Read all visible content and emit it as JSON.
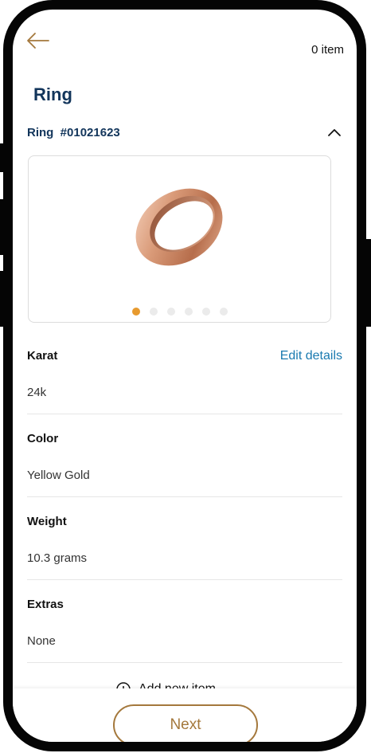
{
  "header": {
    "back_icon": "arrow-left-icon",
    "item_count": "0 item"
  },
  "page": {
    "title": "Ring"
  },
  "ring": {
    "name": "Ring",
    "id": "#01021623",
    "collapse_icon": "chevron-up-icon"
  },
  "gallery": {
    "image": "rose-gold-ring",
    "dot_count": 6,
    "active_index": 0
  },
  "details": {
    "edit_label": "Edit details",
    "fields": [
      {
        "label": "Karat",
        "value": "24k"
      },
      {
        "label": "Color",
        "value": "Yellow Gold"
      },
      {
        "label": "Weight",
        "value": "10.3 grams"
      },
      {
        "label": "Extras",
        "value": "None"
      }
    ]
  },
  "add_item": {
    "icon": "plus-circle-icon",
    "label": "Add new item"
  },
  "footer": {
    "next_label": "Next"
  },
  "colors": {
    "accent": "#a4783c",
    "title": "#12355b",
    "link": "#1a7ab0",
    "active_dot": "#e79a2f"
  }
}
